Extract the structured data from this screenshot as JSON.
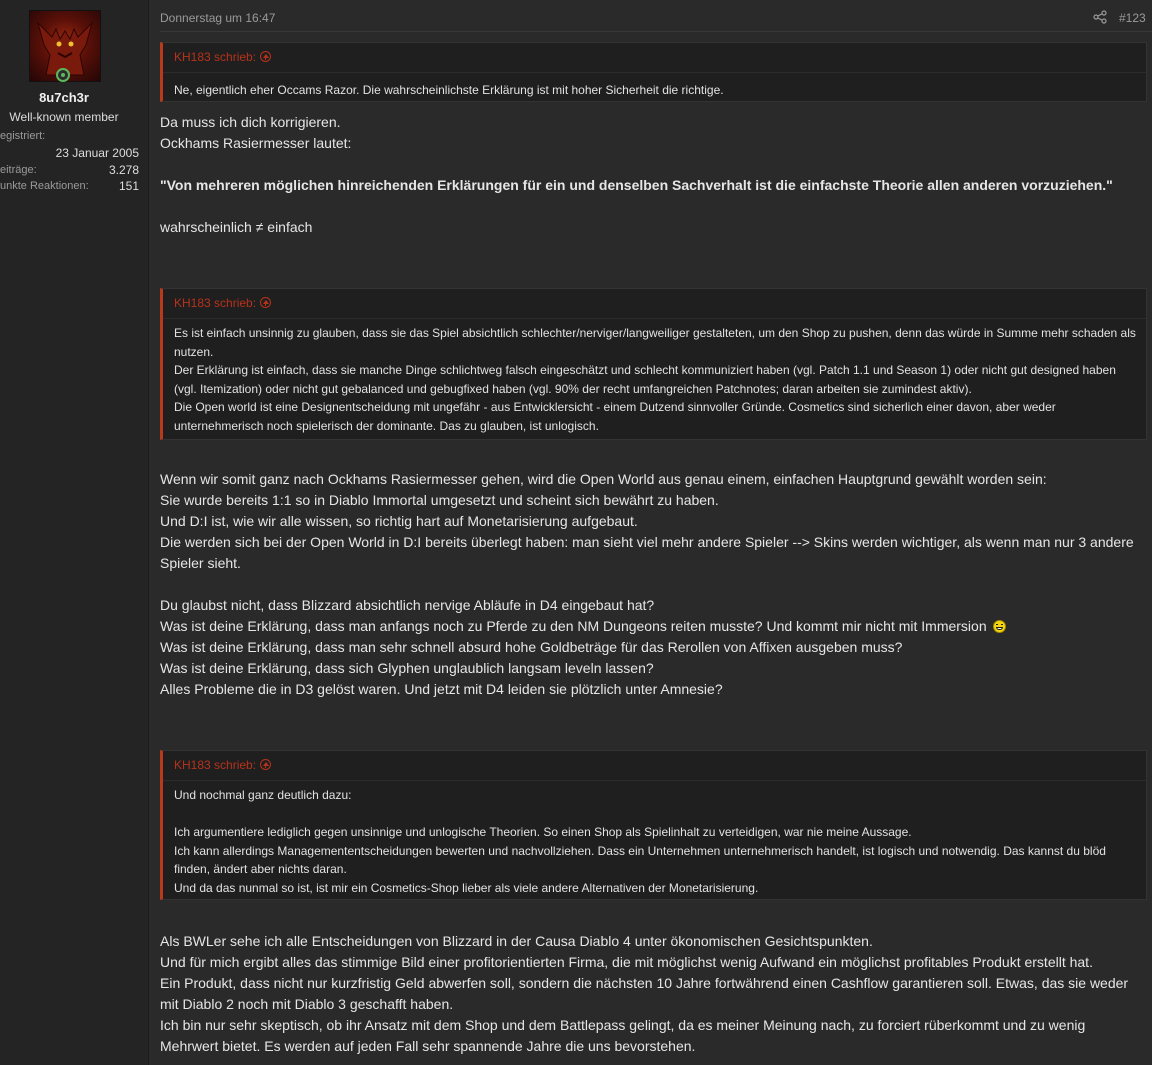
{
  "user": {
    "name": "8u7ch3r",
    "title": "Well-known member",
    "stats": [
      {
        "label": "egistriert:",
        "value": ""
      },
      {
        "label": "",
        "value": "23 Januar 2005"
      },
      {
        "label": "eiträge:",
        "value": "3.278"
      },
      {
        "label": "unkte Reaktionen:",
        "value": "151"
      }
    ]
  },
  "post": {
    "date": "Donnerstag um 16:47",
    "number": "#123"
  },
  "quotes": [
    {
      "author": "KH183 schrieb:",
      "lines": [
        "Ne, eigentlich eher Occams Razor. Die wahrscheinlichste Erklärung ist mit hoher Sicherheit die richtige."
      ]
    },
    {
      "author": "KH183 schrieb:",
      "lines": [
        "Es ist einfach unsinnig zu glauben, dass sie das Spiel absichtlich schlechter/nerviger/langweiliger gestalteten, um den Shop zu pushen, denn das würde in Summe mehr schaden als nutzen.",
        "Der Erklärung ist einfach, dass sie manche Dinge schlichtweg falsch eingeschätzt und schlecht kommuniziert haben (vgl. Patch 1.1 und Season 1) oder nicht gut designed haben (vgl. Itemization) oder nicht gut gebalanced und gebugfixed haben (vgl. 90% der recht umfangreichen Patchnotes; daran arbeiten sie zumindest aktiv).",
        "Die Open world ist eine Designentscheidung mit ungefähr - aus Entwicklersicht - einem Dutzend sinnvoller Gründe. Cosmetics sind sicherlich einer davon, aber weder unternehmerisch noch spielerisch der dominante. Das zu glauben, ist unlogisch."
      ]
    },
    {
      "author": "KH183 schrieb:",
      "lines": [
        "Und nochmal ganz deutlich dazu:",
        "",
        "Ich argumentiere lediglich gegen unsinnige und unlogische Theorien. So einen Shop als Spielinhalt zu verteidigen, war nie meine Aussage.",
        "Ich kann allerdings Managemententscheidungen bewerten und nachvollziehen. Dass ein Unternehmen unternehmerisch handelt, ist logisch und notwendig. Das kannst du blöd finden, ändert aber nichts daran.",
        "Und da das nunmal so ist, ist mir ein Cosmetics-Shop lieber als viele andere Alternativen der Monetarisierung."
      ]
    }
  ],
  "body": {
    "p1": [
      "Da muss ich dich korrigieren.",
      "Ockhams Rasiermesser lautet:"
    ],
    "p1_bold": "\"Von mehreren möglichen hinreichenden Erklärungen für ein und denselben Sachverhalt ist die einfachste Theorie allen anderen vorzuziehen.\"",
    "p1_end": "wahrscheinlich ≠ einfach",
    "p2": [
      "Wenn wir somit ganz nach Ockhams Rasiermesser gehen, wird die Open World aus genau einem, einfachen Hauptgrund gewählt worden sein:",
      "Sie wurde bereits 1:1 so in Diablo Immortal umgesetzt und scheint sich bewährt zu haben.",
      "Und D:I ist, wie wir alle wissen, so richtig hart auf Monetarisierung aufgebaut.",
      "Die werden sich bei der Open World in D:I bereits überlegt haben: man sieht viel mehr andere Spieler --> Skins werden wichtiger, als wenn man nur 3 andere Spieler sieht."
    ],
    "p3": [
      "Du glaubst nicht, dass Blizzard absichtlich nervige Abläufe in D4 eingebaut hat?",
      "Was ist deine Erklärung, dass man anfangs noch zu Pferde zu den NM Dungeons reiten musste? Und kommt mir nicht mit Immersion",
      "Was ist deine Erklärung, dass man sehr schnell absurd hohe Goldbeträge für das Rerollen von Affixen ausgeben muss?",
      "Was ist deine Erklärung, dass sich Glyphen unglaublich langsam leveln lassen?",
      "Alles Probleme die in D3 gelöst waren. Und jetzt mit D4 leiden sie plötzlich unter Amnesie?"
    ],
    "p4": [
      "Als BWLer sehe ich alle Entscheidungen von Blizzard in der Causa Diablo 4 unter ökonomischen Gesichtspunkten.",
      "Und für mich ergibt alles das stimmige Bild einer profitorientierten Firma, die mit möglichst wenig Aufwand ein möglichst profitables Produkt erstellt hat.",
      "Ein Produkt, dass nicht nur kurzfristig Geld abwerfen soll, sondern die nächsten 10 Jahre fortwährend einen Cashflow garantieren soll. Etwas, das sie weder mit Diablo 2 noch mit Diablo 3 geschafft haben.",
      "Ich bin nur sehr skeptisch, ob ihr Ansatz mit dem Shop und dem Battlepass gelingt, da es meiner Meinung nach, zu forciert rüberkommt und zu wenig Mehrwert bietet. Es werden auf jeden Fall sehr spannende Jahre die uns bevorstehen."
    ]
  }
}
